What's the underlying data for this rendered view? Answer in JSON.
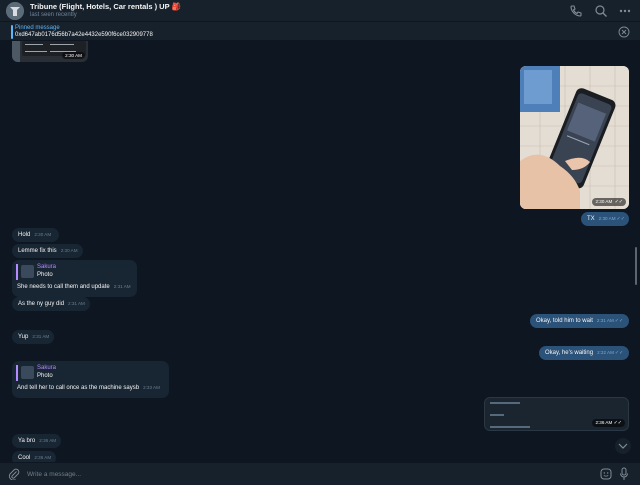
{
  "header": {
    "title": "Tribune (Flight, Hotels, Car rentals ) UP 🎒",
    "subtitle": "last seen recently",
    "icons": [
      "phone-icon",
      "search-icon",
      "more-icon"
    ]
  },
  "pinned": {
    "label": "Pinned message",
    "text": "0xd647ab0176d56b7a42e4432e590f6ce032909778"
  },
  "top_photo": {
    "time": "2:30 AM"
  },
  "hand_photo": {
    "time": "2:30 AM"
  },
  "messages": [
    {
      "text": "TX",
      "time": "2:30 AM",
      "dir": "out"
    },
    {
      "text": "Hold",
      "time": "2:30 AM",
      "dir": "in"
    },
    {
      "text": "Lemme fix this",
      "time": "2:30 AM",
      "dir": "in"
    },
    {
      "reply_name": "Sakura",
      "reply_kind": "Photo",
      "text": "She needs to call them and update",
      "time": "2:31 AM",
      "dir": "in"
    },
    {
      "text": "As the ny guy did",
      "time": "2:31 AM",
      "dir": "in"
    },
    {
      "text": "Okay, told him to wait",
      "time": "2:31 AM",
      "dir": "out"
    },
    {
      "text": "Yup",
      "time": "2:31 AM",
      "dir": "in"
    },
    {
      "text": "Okay, he's waiting",
      "time": "2:32 AM",
      "dir": "out"
    },
    {
      "reply_name": "Sakura",
      "reply_kind": "Photo",
      "text": "And tell her to call once as the machine saysb",
      "time": "2:33 AM",
      "dir": "in"
    },
    {
      "text": "Ya bro",
      "time": "2:36 AM",
      "dir": "in"
    },
    {
      "text": "Cool",
      "time": "2:36 AM",
      "dir": "in"
    }
  ],
  "screenshot_msg": {
    "time": "2:36 AM"
  },
  "input": {
    "placeholder": "Write a message..."
  },
  "colors": {
    "background": "#0e1621",
    "bar": "#17212b",
    "incoming": "#182533",
    "outgoing": "#2b5278",
    "accent": "#5eb5f7",
    "reply_name": "#b48bff"
  }
}
